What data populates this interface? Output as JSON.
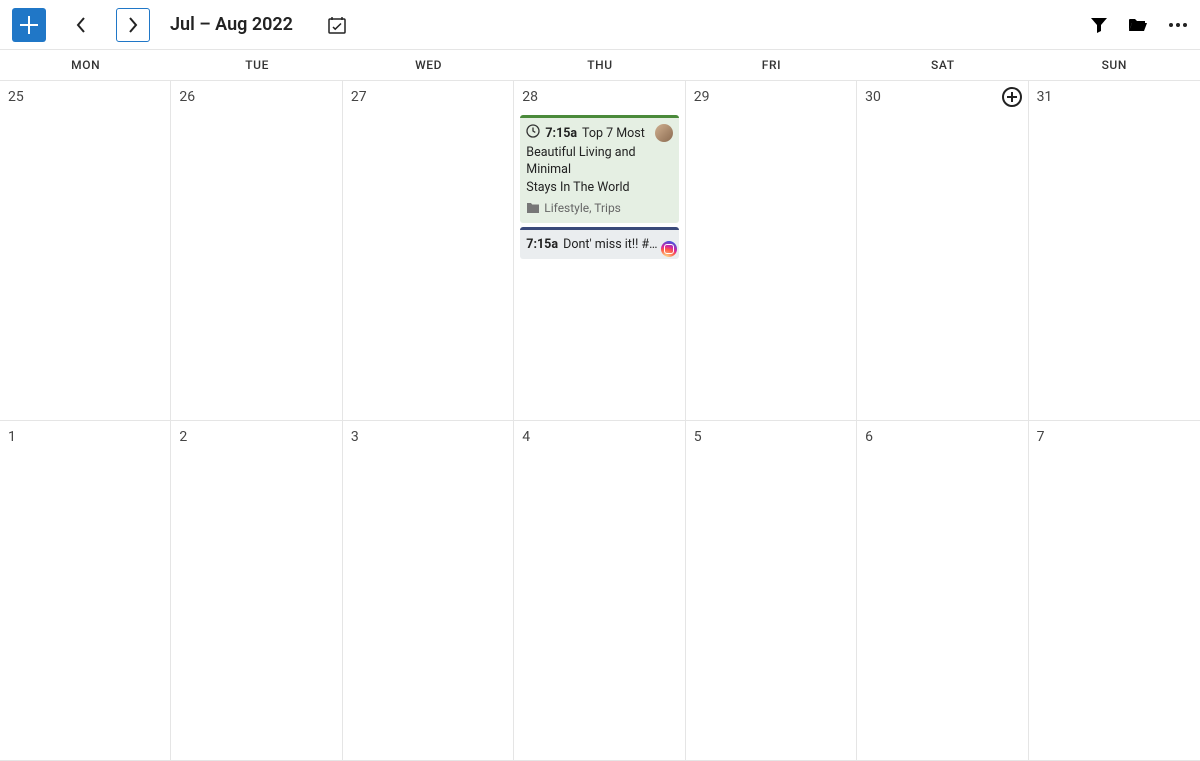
{
  "toolbar": {
    "period_title": "Jul – Aug 2022"
  },
  "day_headers": [
    "MON",
    "TUE",
    "WED",
    "THU",
    "FRI",
    "SAT",
    "SUN"
  ],
  "weeks": [
    {
      "days": [
        {
          "num": "25"
        },
        {
          "num": "26"
        },
        {
          "num": "27"
        },
        {
          "num": "28"
        },
        {
          "num": "29"
        },
        {
          "num": "30",
          "show_add": true
        },
        {
          "num": "31"
        }
      ]
    },
    {
      "days": [
        {
          "num": "1"
        },
        {
          "num": "2"
        },
        {
          "num": "3"
        },
        {
          "num": "4"
        },
        {
          "num": "5"
        },
        {
          "num": "6"
        },
        {
          "num": "7"
        }
      ]
    }
  ],
  "events": {
    "thu": {
      "card1": {
        "time": "7:15a",
        "title_rest": "Top 7 Most",
        "title_line2": "Beautiful Living and Minimal",
        "title_line3": "Stays In The World",
        "categories": "Lifestyle, Trips"
      },
      "card2": {
        "time": "7:15a",
        "title": "Dont' miss it!! #…"
      }
    }
  }
}
